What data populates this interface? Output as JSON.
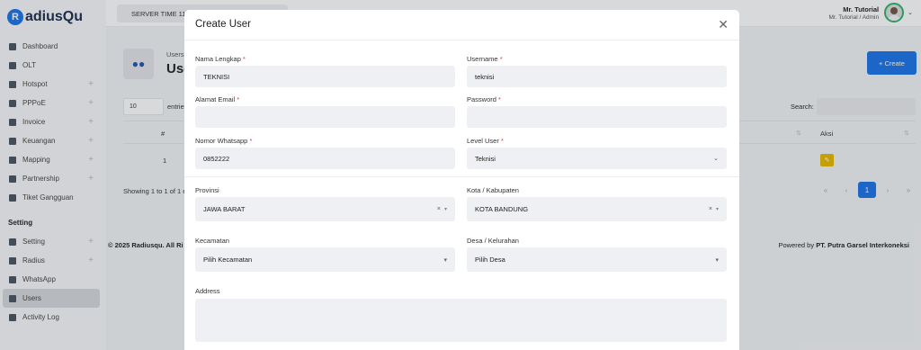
{
  "app": {
    "logo_letter": "R",
    "logo_text": "adiusQu"
  },
  "sidebar": {
    "items": [
      {
        "label": "Dashboard",
        "expandable": false
      },
      {
        "label": "OLT",
        "expandable": false
      },
      {
        "label": "Hotspot",
        "expandable": true
      },
      {
        "label": "PPPoE",
        "expandable": true
      },
      {
        "label": "Invoice",
        "expandable": true
      },
      {
        "label": "Keuangan",
        "expandable": true
      },
      {
        "label": "Mapping",
        "expandable": true
      },
      {
        "label": "Partnership",
        "expandable": true
      },
      {
        "label": "Tiket Gangguan",
        "expandable": false
      }
    ],
    "section_title": "Setting",
    "setting_items": [
      {
        "label": "Setting",
        "expandable": true
      },
      {
        "label": "Radius",
        "expandable": true
      },
      {
        "label": "WhatsApp",
        "expandable": false
      },
      {
        "label": "Users",
        "expandable": false,
        "active": true
      },
      {
        "label": "Activity Log",
        "expandable": false
      }
    ],
    "plus_glyph": "+"
  },
  "topbar": {
    "server_time": "SERVER TIME 11",
    "user_name": "Mr. Tutorial",
    "user_role": "Mr. Tutorial / Admin",
    "dropdown_glyph": "⌄"
  },
  "page": {
    "subtitle": "Users",
    "title": "Use",
    "create_label": "+ Create"
  },
  "table": {
    "entries_value": "10",
    "entries_label": "entrie",
    "search_label": "Search:",
    "col_no": "#",
    "col_aksi": "Aksi",
    "row_no": "1",
    "showing": "Showing 1 to 1 of 1 e",
    "pagination": {
      "first": "«",
      "prev": "‹",
      "current": "1",
      "next": "›",
      "last": "»"
    }
  },
  "footer": {
    "copyright": "© 2025 Radiusqu. All Ri",
    "powered_prefix": "Powered by ",
    "powered_company": "PT. Putra Garsel Interkoneksi"
  },
  "modal": {
    "title": "Create User",
    "close_glyph": "✕",
    "fields": {
      "nama_lengkap": {
        "label": "Nama Lengkap",
        "value": "TEKNISI"
      },
      "username": {
        "label": "Username",
        "value": "teknisi"
      },
      "email": {
        "label": "Alamat Email",
        "value": ""
      },
      "password": {
        "label": "Password",
        "value": ""
      },
      "whatsapp": {
        "label": "Nomor Whatsapp",
        "value": "0852222"
      },
      "level_user": {
        "label": "Level User",
        "value": "Teknisi"
      },
      "provinsi": {
        "label": "Provinsi",
        "value": "JAWA BARAT"
      },
      "kota": {
        "label": "Kota / Kabupaten",
        "value": "KOTA BANDUNG"
      },
      "kecamatan": {
        "label": "Kecamatan",
        "value": "Pilih Kecamatan"
      },
      "desa": {
        "label": "Desa / Kelurahan",
        "value": "Pilih Desa"
      },
      "address": {
        "label": "Address",
        "value": ""
      }
    },
    "required_mark": "*",
    "clear_glyph": "×",
    "caret_glyph": "▾",
    "chevron_glyph": "⌄"
  },
  "colors": {
    "primary": "#1a73e8",
    "required": "#e53935",
    "edit": "#e8b800"
  }
}
